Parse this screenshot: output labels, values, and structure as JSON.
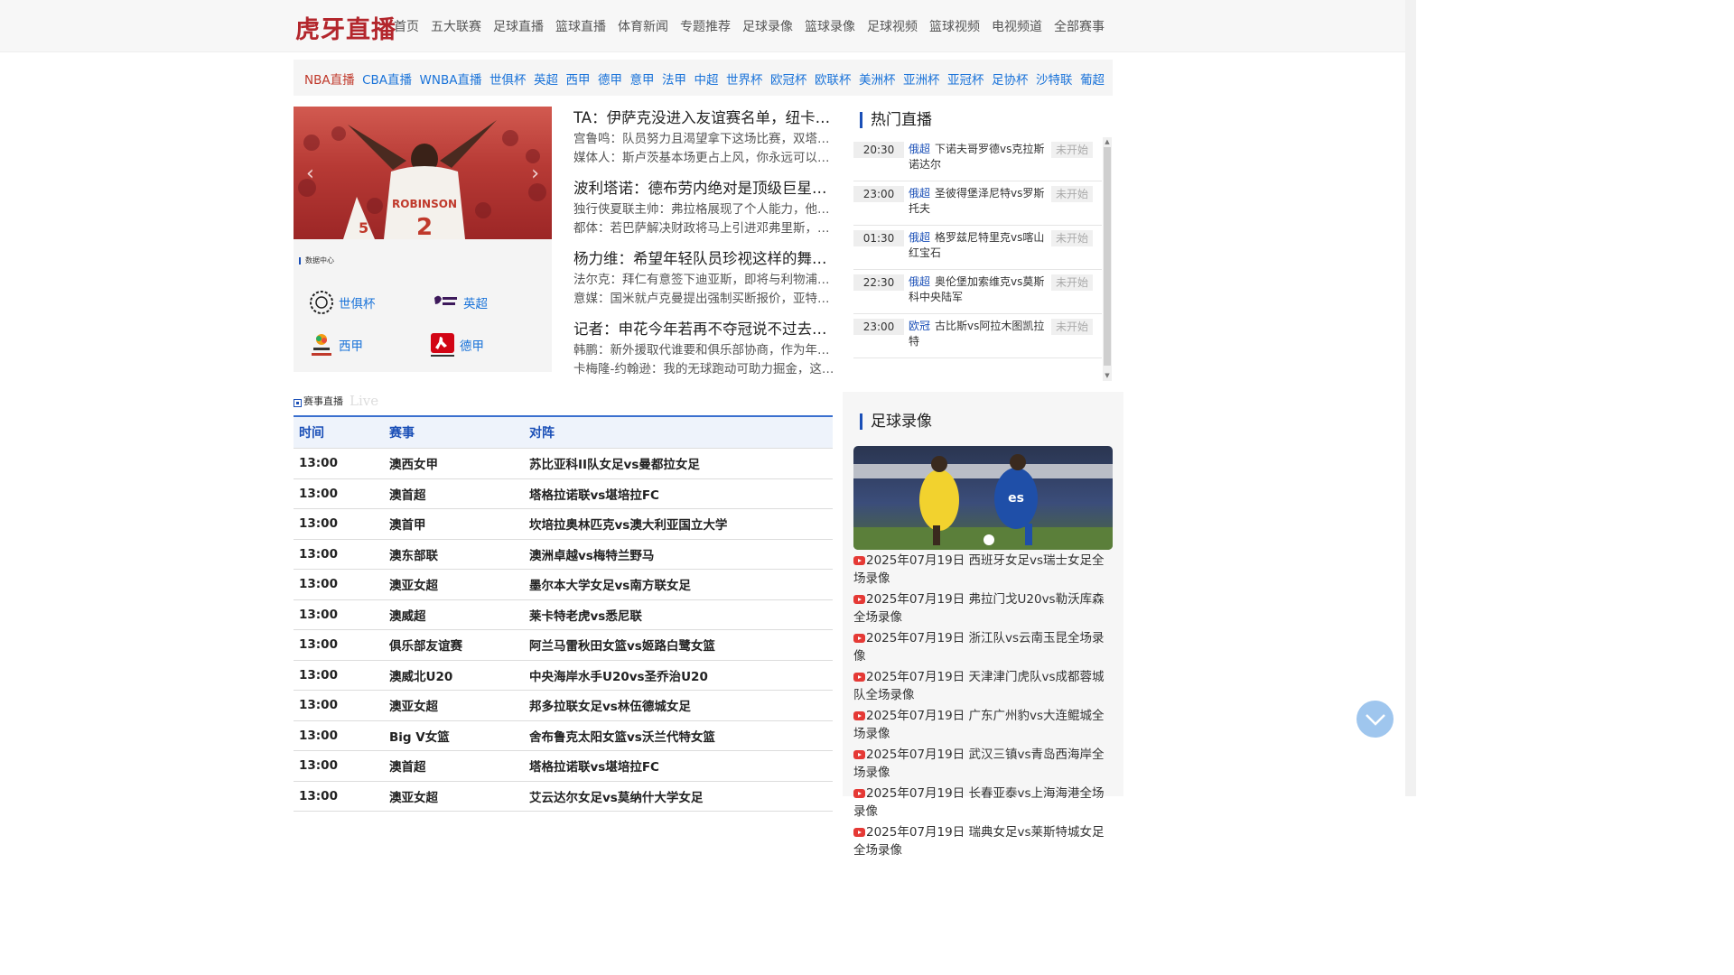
{
  "header": {
    "logo": "虎牙直播",
    "nav": [
      "首页",
      "五大联赛",
      "足球直播",
      "篮球直播",
      "体育新闻",
      "专题推荐",
      "足球录像",
      "篮球录像",
      "足球视频",
      "篮球视频",
      "电视频道",
      "全部赛事"
    ]
  },
  "leagues": [
    "NBA直播",
    "CBA直播",
    "WNBA直播",
    "世俱杯",
    "英超",
    "西甲",
    "德甲",
    "意甲",
    "法甲",
    "中超",
    "世界杯",
    "欧冠杯",
    "欧联杯",
    "美洲杯",
    "亚洲杯",
    "亚冠杯",
    "足协杯",
    "沙特联",
    "葡超"
  ],
  "data_center": {
    "title": "数据中心",
    "items": [
      "世俱杯",
      "英超",
      "西甲",
      "德甲"
    ]
  },
  "news": [
    {
      "title": "TA：伊萨克没进入友谊赛名单，纽卡斯尔正积极寻找替代者",
      "subs": [
        "宫鲁鸣：队员努力且渴望拿下这场比赛，双塔阵容打出了效果",
        "媒体人：斯卢茨基本场更占上风，你永远可以信任他的临场指挥"
      ]
    },
    {
      "title": "波利塔诺：德布劳内绝对是顶级巨星，他的到来提升了球队",
      "subs": [
        "独行侠夏联主帅：弗拉格展现了个人能力，他的领导力很出色",
        "都体：若巴萨解决财政将马上引进邓弗里斯，门将也在考察之中"
      ]
    },
    {
      "title": "杨力维：希望年轻队员珍视这样的舞台，在比赛中不断成长",
      "subs": [
        "法尔克：拜仁有意签下迪亚斯，即将与利物浦会谈转会费用",
        "意媒：国米就卢克曼提出强制买断报价，亚特兰大仍未回应"
      ]
    },
    {
      "title": "记者：申花今年若再不夺冠说不过去，球队阵容实力非常强",
      "subs": [
        "韩鹏：新外援取代谁要和俱乐部协商，作为年轻教练还在学习",
        "卡梅隆-约翰逊：我的无球跑动可助力掘金，这是我擅长的"
      ]
    }
  ],
  "hot_live": {
    "title": "热门直播",
    "rows": [
      {
        "time": "20:30",
        "league": "俄超",
        "match": "下诺夫哥罗德vs克拉斯诺达尔",
        "status": "未开始"
      },
      {
        "time": "23:00",
        "league": "俄超",
        "match": "圣彼得堡泽尼特vs罗斯托夫",
        "status": "未开始"
      },
      {
        "time": "01:30",
        "league": "俄超",
        "match": "格罗兹尼特里克vs喀山红宝石",
        "status": "未开始"
      },
      {
        "time": "22:30",
        "league": "俄超",
        "match": "奥伦堡加索维克vs莫斯科中央陆军",
        "status": "未开始"
      },
      {
        "time": "23:00",
        "league": "欧冠",
        "match": "古比斯vs阿拉木图凯拉特",
        "status": "未开始"
      }
    ]
  },
  "live_section": {
    "title": "赛事直播",
    "en": "Live",
    "headers": [
      "时间",
      "赛事",
      "对阵"
    ],
    "rows": [
      [
        "13:00",
        "澳西女甲",
        "苏比亚科II队女足vs曼都拉女足"
      ],
      [
        "13:00",
        "澳首超",
        "塔格拉诺联vs堪培拉FC"
      ],
      [
        "13:00",
        "澳首甲",
        "坎培拉奥林匹克vs澳大利亚国立大学"
      ],
      [
        "13:00",
        "澳东部联",
        "澳洲卓越vs梅特兰野马"
      ],
      [
        "13:00",
        "澳亚女超",
        "墨尔本大学女足vs南方联女足"
      ],
      [
        "13:00",
        "澳威超",
        "莱卡特老虎vs悉尼联"
      ],
      [
        "13:00",
        "俱乐部友谊赛",
        "阿兰马雷秋田女篮vs姬路白鹭女篮"
      ],
      [
        "13:00",
        "澳威北U20",
        "中央海岸水手U20vs圣乔治U20"
      ],
      [
        "13:00",
        "澳亚女超",
        "邦多拉联女足vs林伍德城女足"
      ],
      [
        "13:00",
        "Big V女篮",
        "舍布鲁克太阳女篮vs沃兰代特女篮"
      ],
      [
        "13:00",
        "澳首超",
        "塔格拉诺联vs堪培拉FC"
      ],
      [
        "13:00",
        "澳亚女超",
        "艾云达尔女足vs莫纳什大学女足"
      ]
    ]
  },
  "football_video": {
    "title": "足球录像",
    "items": [
      "2025年07月19日 西班牙女足vs瑞士女足全场录像",
      "2025年07月19日 弗拉门戈U20vs勒沃库森全场录像",
      "2025年07月19日 浙江队vs云南玉昆全场录像",
      "2025年07月19日 天津津门虎队vs成都蓉城队全场录像",
      "2025年07月19日 广东广州豹vs大连鲲城全场录像",
      "2025年07月19日 武汉三镇vs青岛西海岸全场录像",
      "2025年07月19日 长春亚泰vs上海海港全场录像",
      "2025年07月19日 瑞典女足vs莱斯特城女足全场录像"
    ]
  },
  "colors": {
    "brand": "#b3262c",
    "link": "#1a73d9",
    "accent": "#1a4fb7"
  }
}
